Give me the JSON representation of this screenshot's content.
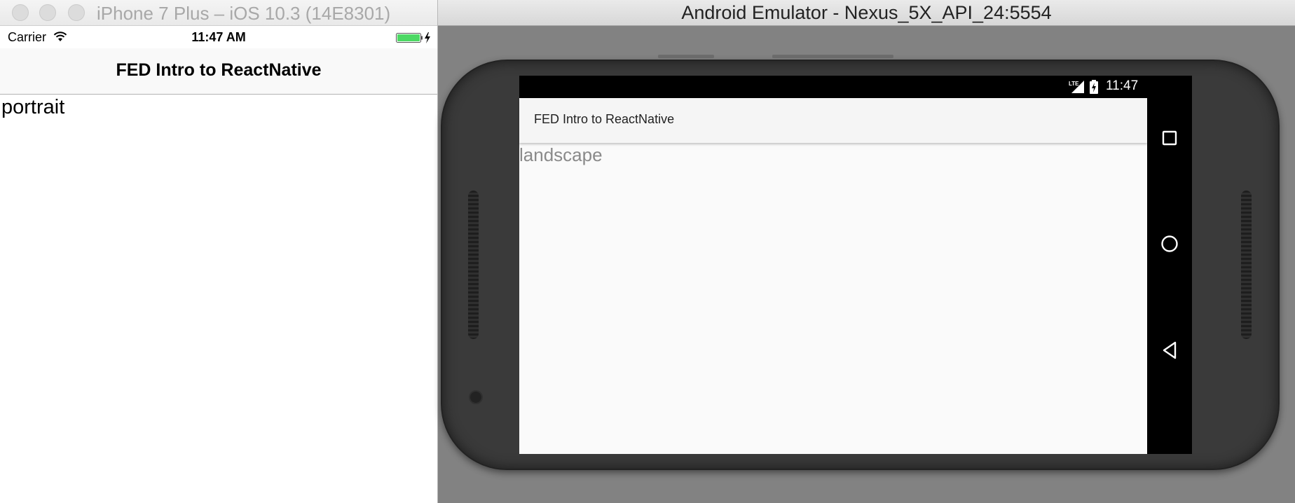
{
  "ios": {
    "window_title": "iPhone 7 Plus – iOS 10.3 (14E8301)",
    "status": {
      "carrier": "Carrier",
      "time": "11:47 AM"
    },
    "nav_title": "FED Intro to ReactNative",
    "orientation_text": "portrait"
  },
  "android": {
    "window_title": "Android Emulator - Nexus_5X_API_24:5554",
    "status": {
      "time": "11:47"
    },
    "toolbar_title": "FED Intro to ReactNative",
    "orientation_text": "landscape",
    "nav_buttons": [
      "overview-square-icon",
      "home-circle-icon",
      "back-triangle-icon"
    ]
  },
  "colors": {
    "battery_green": "#4cd964",
    "android_window_bg": "#828282",
    "phone_body": "#3a3a3a"
  }
}
